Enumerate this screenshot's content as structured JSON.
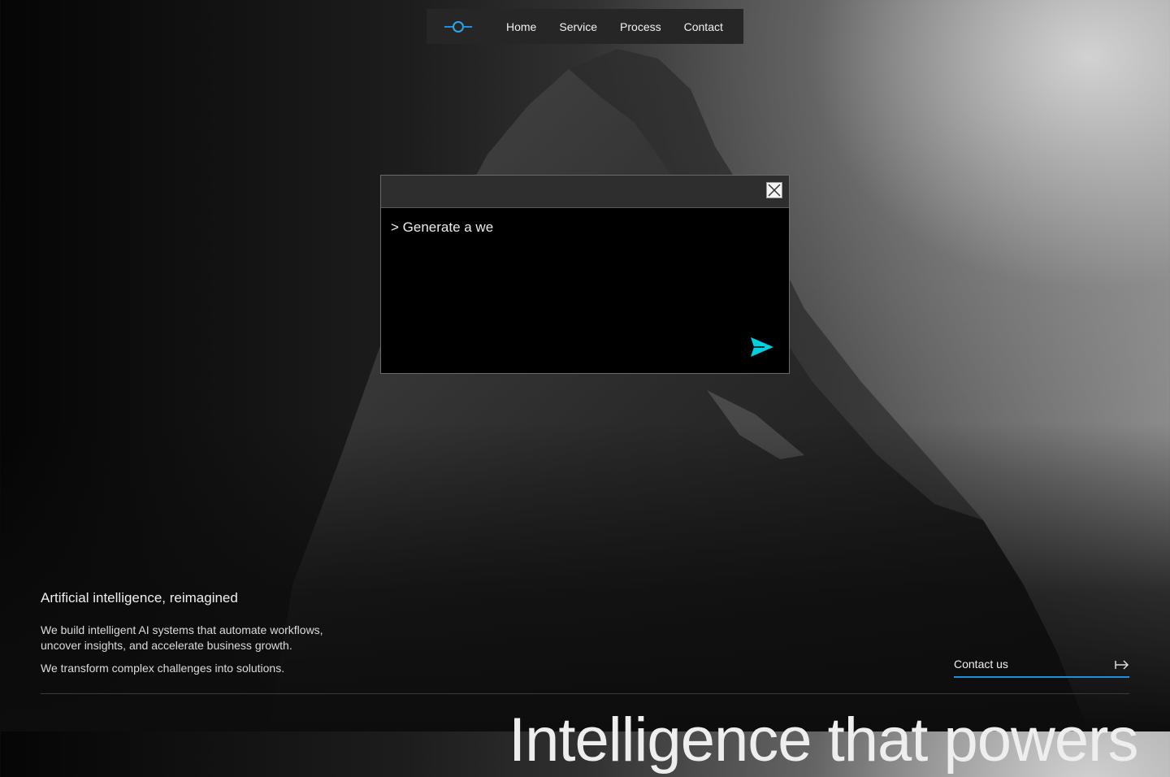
{
  "nav": {
    "links": [
      {
        "label": "Home"
      },
      {
        "label": "Service"
      },
      {
        "label": "Process"
      },
      {
        "label": "Contact"
      }
    ]
  },
  "modal": {
    "prompt_text": "> Generate a we",
    "accent_color": "#00d0e0"
  },
  "hero": {
    "tagline": "Artificial intelligence, reimagined",
    "description_1": "We build intelligent AI systems that automate workflows, uncover insights, and accelerate business growth.",
    "description_2": "We transform complex challenges into solutions.",
    "contact_label": "Contact us",
    "headline": "Intelligence that powers"
  },
  "colors": {
    "accent_blue": "#1e90e0",
    "nav_bg": "#262626"
  }
}
